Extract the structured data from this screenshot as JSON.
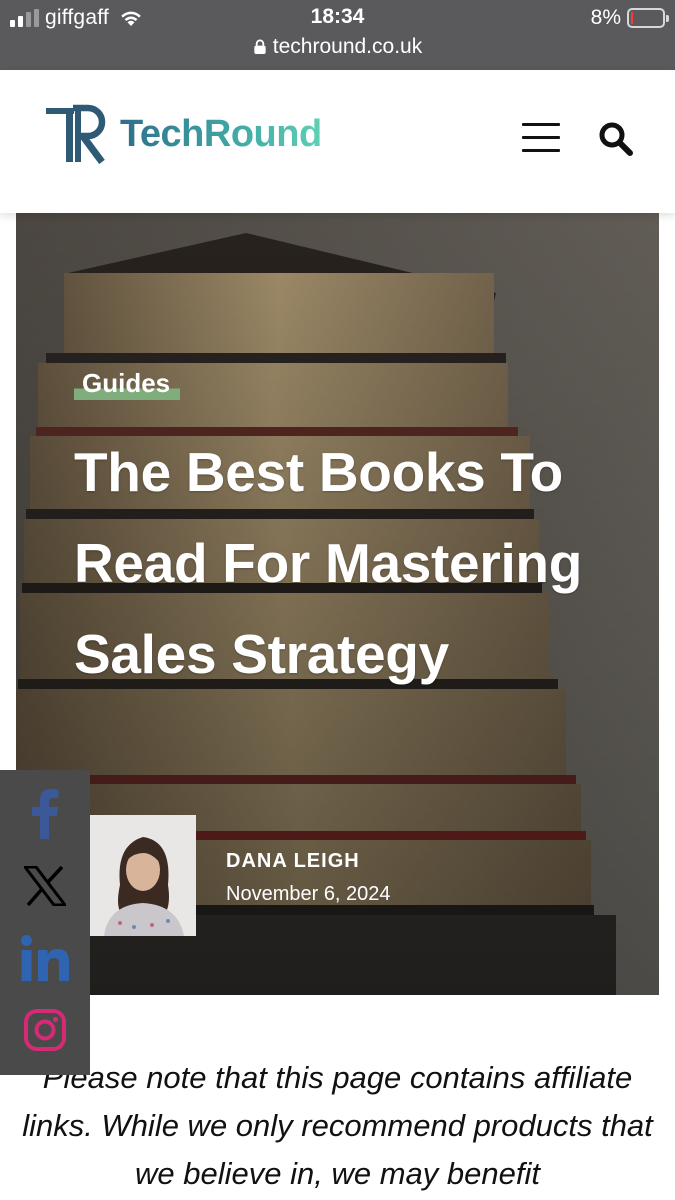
{
  "status_bar": {
    "carrier": "giffgaff",
    "time": "18:34",
    "battery_percent": "8%",
    "battery_level": 0.08,
    "url": "techround.co.uk",
    "signal_bars": 2
  },
  "header": {
    "logo_mark": "TR",
    "logo_text": "TechRound",
    "menu_icon": "hamburger-icon",
    "search_icon": "search-icon"
  },
  "article": {
    "category": "Guides",
    "title": "The Best Books To Read For Mastering Sales Strategy",
    "author": "DANA LEIGH",
    "date": "November 6, 2024"
  },
  "share": [
    {
      "network": "facebook",
      "icon": "facebook-icon",
      "color": "#3b5998"
    },
    {
      "network": "x",
      "icon": "x-icon",
      "color": "#000000"
    },
    {
      "network": "linkedin",
      "icon": "linkedin-icon",
      "color": "#2e64b0"
    },
    {
      "network": "instagram",
      "icon": "instagram-icon",
      "color": "#d62976"
    }
  ],
  "disclaimer": "Please note that this page contains affiliate links. While we only recommend products that we believe in, we may benefit",
  "colors": {
    "status_bar": "#5a5a5c",
    "brand_dark": "#2f5a75",
    "brand_teal": "#5fd0b6",
    "category_highlight": "#7fae7c",
    "share_rail": "#4a4a4a"
  }
}
